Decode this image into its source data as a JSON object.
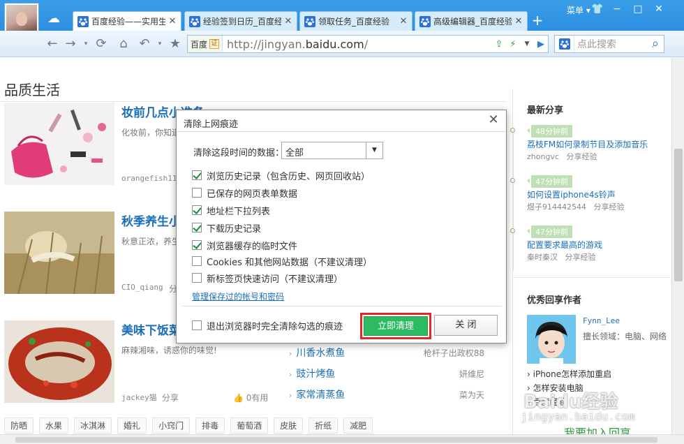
{
  "browser": {
    "tabs": [
      {
        "title": "百度经验——实用生",
        "active": true
      },
      {
        "title": "经验签到日历_百度经",
        "active": false
      },
      {
        "title": "领取任务_百度经验",
        "active": false
      },
      {
        "title": "高级编辑器_百度经验",
        "active": false
      }
    ],
    "new_tab_label": "+",
    "menu_label": "菜单",
    "address": {
      "site_label": "百度",
      "cert_label": "证",
      "url_prefix": "http://jingyan.",
      "url_domain": "baidu.com",
      "url_suffix": "/"
    },
    "search_placeholder": "点此搜索",
    "accent_color": "#2d8fe0"
  },
  "page": {
    "section_title": "品质生活",
    "articles": [
      {
        "title": "妆前几点小准备",
        "desc": "化妆前，你知道",
        "author": "orangefish11",
        "share": "",
        "useful": ""
      },
      {
        "title": "秋季养生小",
        "desc": "秋意正浓，养生",
        "author": "CIO_qiang",
        "share": "分",
        "useful": ""
      },
      {
        "title": "美味下饭菜",
        "desc": "麻辣湘味，诱惑你的味觉!",
        "author": "jackey猫",
        "share": "分享",
        "useful": "0有用"
      }
    ],
    "right_list": [
      {
        "title": "川香水煮鱼",
        "author": "枪杆子出政权88"
      },
      {
        "title": "豉汁烤鱼",
        "author": "妍维尼"
      },
      {
        "title": "家常清蒸鱼",
        "author": "菜为天"
      }
    ],
    "tags": [
      "防晒",
      "水果",
      "冰淇淋",
      "婚礼",
      "小窍门",
      "排毒",
      "葡萄酒",
      "皮肤",
      "折纸",
      "减肥"
    ]
  },
  "sidebar": {
    "latest_title": "最新分享",
    "feed": [
      {
        "time": "48分钟前",
        "title": "荔枝FM如何录制节目及添加音乐",
        "author": "zhongvc",
        "action": "分享经验"
      },
      {
        "time": "47分钟前",
        "title": "如何设置iphone4s铃声",
        "author": "煜子914442544",
        "action": "分享经验"
      },
      {
        "time": "47分钟前",
        "title": "配置要求最高的游戏",
        "author": "秦时秦汉",
        "action": "分享经验"
      }
    ],
    "top_authors_title": "优秀回享作者",
    "top_author": {
      "name": "Fynn_Lee",
      "field": "擅长领域：电脑、网络"
    },
    "author_links": [
      "iPhone怎样添加重启",
      "怎样安装电脑",
      "百度经验"
    ],
    "join_label": "我要加入回享",
    "watermark": "Baidu经验",
    "watermark_url": "jingyan.baidu.com"
  },
  "dialog": {
    "title": "清除上网痕迹",
    "range_label": "清除这段时间的数据：",
    "range_value": "全部",
    "options": [
      {
        "label": "浏览历史记录（包含历史、网页回收站）",
        "checked": true
      },
      {
        "label": "已保存的网页表单数据",
        "checked": false
      },
      {
        "label": "地址栏下拉列表",
        "checked": true
      },
      {
        "label": "下载历史记录",
        "checked": true
      },
      {
        "label": "浏览器缓存的临时文件",
        "checked": true
      },
      {
        "label": "Cookies 和其他网站数据（不建议清理）",
        "checked": false
      },
      {
        "label": "新标签页快速访问（不建议清理）",
        "checked": false
      }
    ],
    "manage_link": "管理保存过的帐号和密码",
    "auto_clear_label": "退出浏览器时完全清除勾选的痕迹",
    "auto_clear_checked": false,
    "clear_button": "立即清理",
    "close_button": "关 闭",
    "highlight_color": "#e3272d",
    "clear_color": "#2cbb62"
  }
}
